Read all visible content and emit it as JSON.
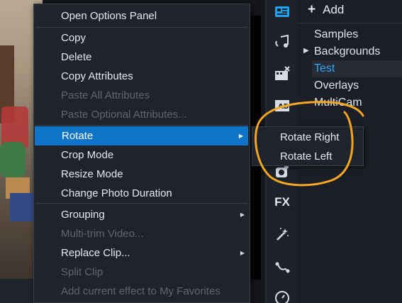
{
  "context_menu": {
    "items": [
      {
        "label": "Open Options Panel",
        "disabled": false
      },
      {
        "label": "Copy",
        "disabled": false
      },
      {
        "label": "Delete",
        "disabled": false
      },
      {
        "label": "Copy Attributes",
        "disabled": false
      },
      {
        "label": "Paste All Attributes",
        "disabled": true
      },
      {
        "label": "Paste Optional Attributes...",
        "disabled": true
      },
      {
        "label": "Rotate",
        "disabled": false,
        "highlighted": true,
        "has_submenu": true
      },
      {
        "label": "Crop Mode",
        "disabled": false
      },
      {
        "label": "Resize Mode",
        "disabled": false
      },
      {
        "label": "Change Photo Duration",
        "disabled": false
      },
      {
        "label": "Grouping",
        "disabled": false,
        "has_submenu": true
      },
      {
        "label": "Multi-trim Video...",
        "disabled": true
      },
      {
        "label": "Replace Clip...",
        "disabled": false,
        "has_submenu": true
      },
      {
        "label": "Split Clip",
        "disabled": true
      },
      {
        "label": "Add current effect to My Favorites",
        "disabled": true
      }
    ]
  },
  "rotate_submenu": {
    "items": [
      {
        "label": "Rotate Right"
      },
      {
        "label": "Rotate Left"
      }
    ]
  },
  "library": {
    "add_label": "Add",
    "tree": [
      {
        "label": "Samples"
      },
      {
        "label": "Backgrounds",
        "expandable": true
      },
      {
        "label": "Test",
        "selected": true
      },
      {
        "label": "Overlays"
      },
      {
        "label": "MultiCam"
      }
    ]
  },
  "toolbar": {
    "icons": [
      "media-icon",
      "audio-icon",
      "instant-project-icon",
      "title-icon",
      "transition-icon",
      "fx-icon",
      "magic-wand-icon",
      "path-icon",
      "timer-icon"
    ],
    "fx_label": "FX"
  },
  "colors": {
    "highlight": "#0f73c8",
    "selected_text": "#2ea6f2",
    "annotation": "#f5a623"
  }
}
